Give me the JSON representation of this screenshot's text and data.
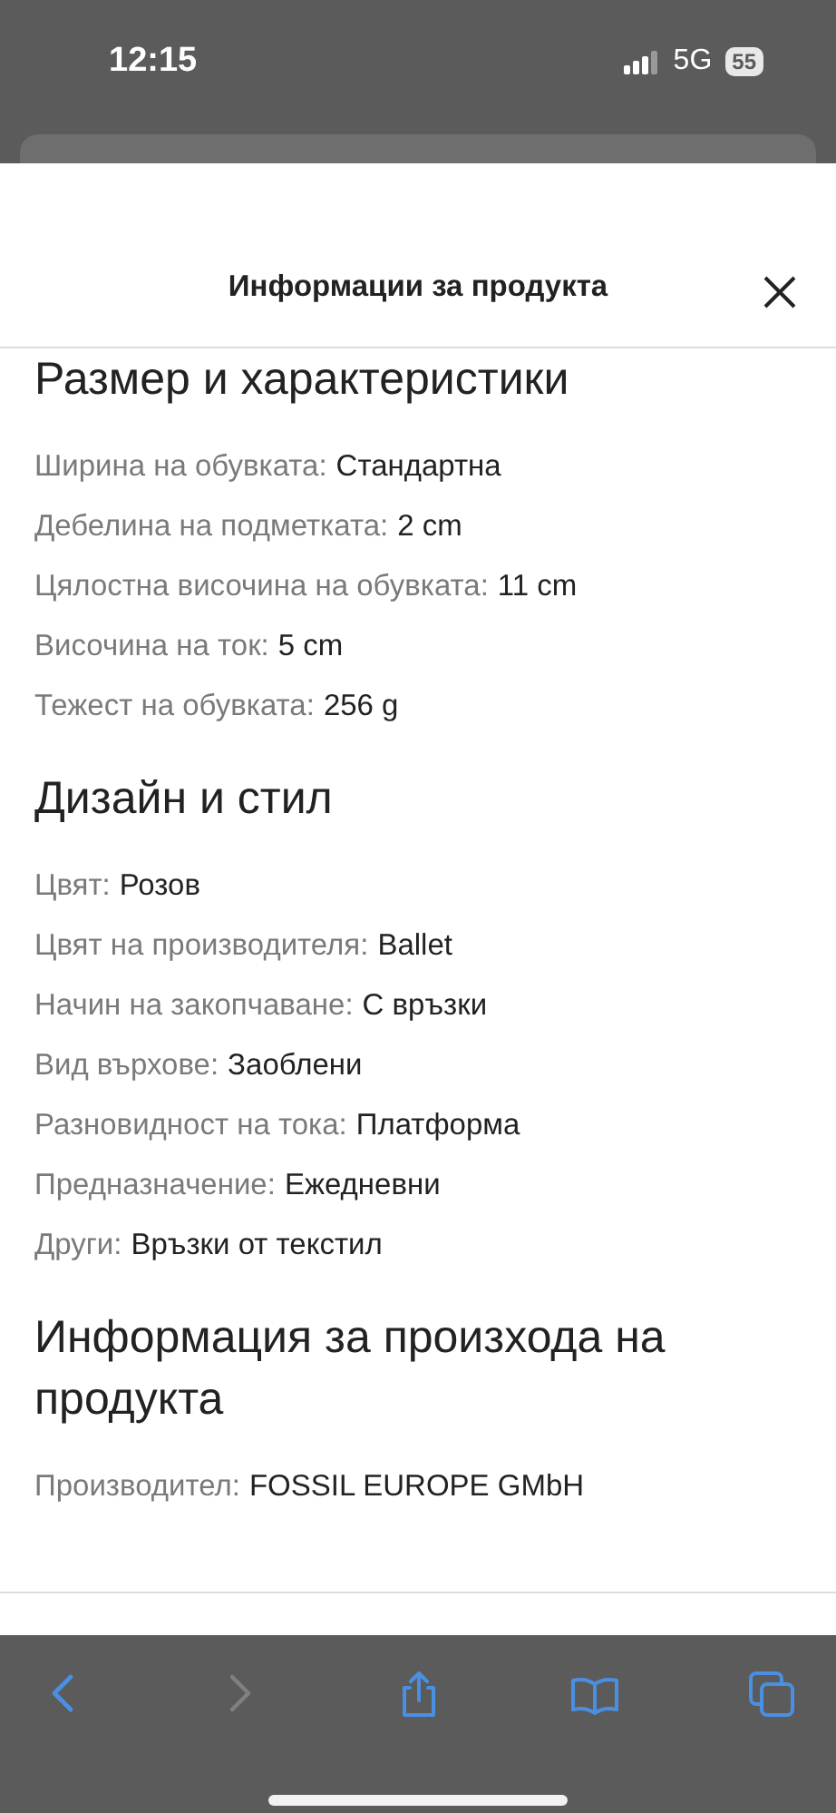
{
  "status_bar": {
    "time": "12:15",
    "network": "5G",
    "battery": "55"
  },
  "sheet": {
    "title": "Информации за продукта",
    "sections": [
      {
        "heading": "Размер и характеристики",
        "rows": [
          {
            "label": "Ширина на обувката:",
            "value": "Стандартна"
          },
          {
            "label": "Дебелина на подметката:",
            "value": "2 cm"
          },
          {
            "label": "Цялостна височина на обувката:",
            "value": "11 cm"
          },
          {
            "label": "Височина на ток:",
            "value": "5 cm"
          },
          {
            "label": "Тежест на обувката:",
            "value": "256 g"
          }
        ]
      },
      {
        "heading": "Дизайн и стил",
        "rows": [
          {
            "label": "Цвят:",
            "value": "Розов"
          },
          {
            "label": "Цвят на производителя:",
            "value": "Ballet"
          },
          {
            "label": "Начин на закопчаване:",
            "value": "С връзки"
          },
          {
            "label": "Вид върхове:",
            "value": "Заоблени"
          },
          {
            "label": "Разновидност на тока:",
            "value": "Платформа"
          },
          {
            "label": "Предназначение:",
            "value": "Ежедневни"
          },
          {
            "label": "Други:",
            "value": "Връзки от текстил"
          }
        ]
      },
      {
        "heading": "Информация за произхода на продукта",
        "rows": [
          {
            "label": "Производител:",
            "value": "FOSSIL EUROPE GMbH"
          }
        ]
      }
    ]
  },
  "toolbar": {
    "buttons": [
      {
        "kind": "back",
        "disabled": false
      },
      {
        "kind": "forward",
        "disabled": true
      },
      {
        "kind": "share",
        "disabled": false
      },
      {
        "kind": "bookmarks",
        "disabled": false
      },
      {
        "kind": "tabs",
        "disabled": false
      }
    ]
  }
}
